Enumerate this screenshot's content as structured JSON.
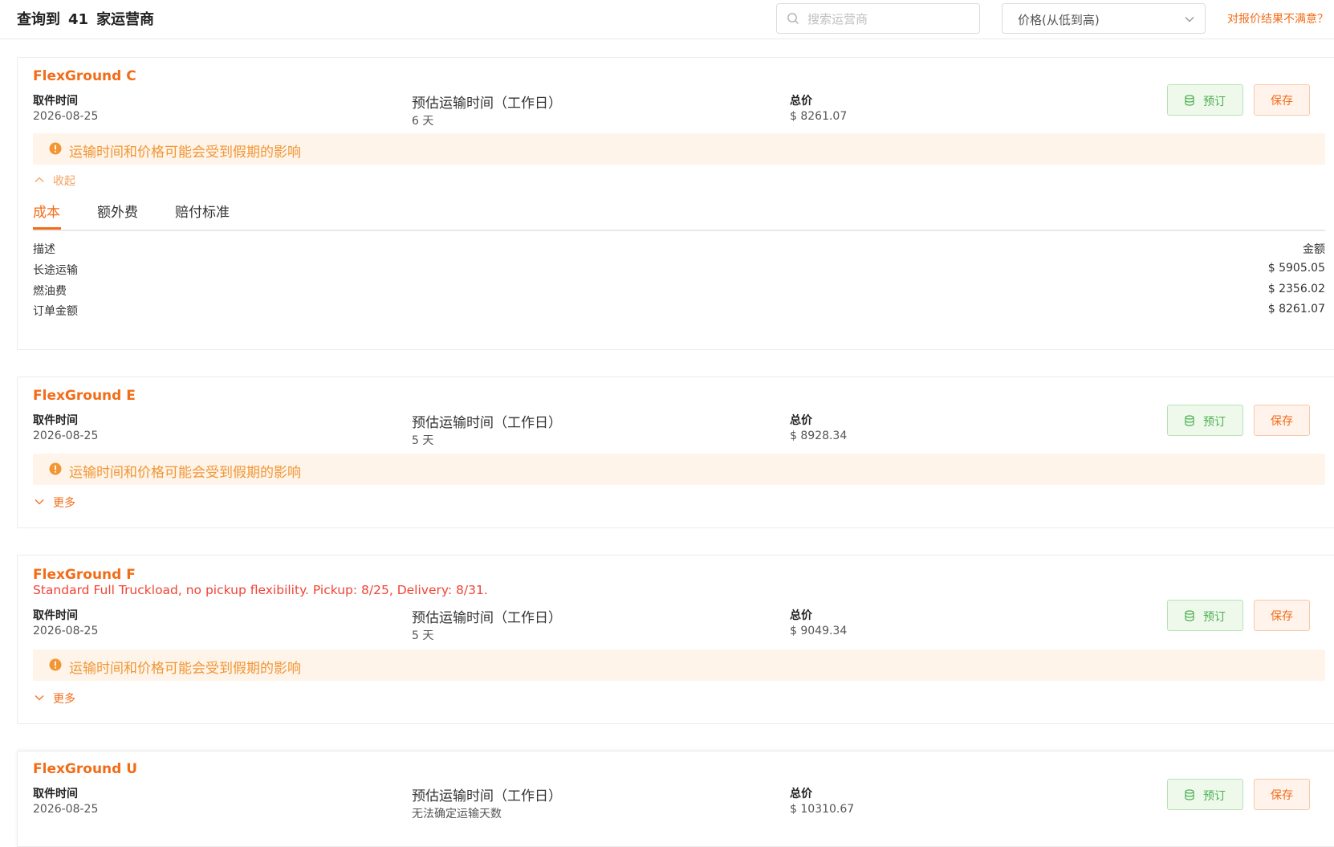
{
  "header": {
    "prefix": "查询到",
    "count": "41",
    "suffix": "家运营商",
    "search_placeholder": "搜索运营商",
    "sort_value": "价格(从低到高)",
    "unsatisfied_link": "对报价结果不满意？"
  },
  "labels": {
    "pickup": "取件时间",
    "transit": "预估运输时间（工作日）",
    "total": "总价",
    "book": "预订",
    "save": "保存",
    "notice": "运输时间和价格可能会受到假期的影响",
    "collapse": "收起",
    "more": "更多"
  },
  "colors": {
    "brand": "#f26c18",
    "note_red": "#f04436",
    "notice_text": "#f29634",
    "notice_bg": "#fef4ea",
    "book_green": "#4caf50"
  },
  "cards": [
    {
      "name": "FlexGround C",
      "pickup_date": "2026-08-25",
      "transit_days": "6 天",
      "total_price": "$ 8261.07",
      "tabs": [
        "成本",
        "额外费",
        "赔付标准"
      ],
      "cost_header": {
        "desc": "描述",
        "amount": "金额"
      },
      "cost_items": [
        {
          "desc": "长途运输",
          "amount": "$ 5905.05"
        },
        {
          "desc": "燃油费",
          "amount": "$ 2356.02"
        },
        {
          "desc": "订单金额",
          "amount": "$ 8261.07"
        }
      ]
    },
    {
      "name": "FlexGround E",
      "pickup_date": "2026-08-25",
      "transit_days": "5 天",
      "total_price": "$ 8928.34"
    },
    {
      "name": "FlexGround F",
      "note": "Standard Full Truckload, no pickup flexibility. Pickup: 8/25, Delivery: 8/31.",
      "pickup_date": "2026-08-25",
      "transit_days": "5 天",
      "total_price": "$ 9049.34"
    },
    {
      "name": "FlexGround U",
      "pickup_date": "2026-08-25",
      "transit_days": "无法确定运输天数",
      "total_price": "$ 10310.67"
    }
  ]
}
